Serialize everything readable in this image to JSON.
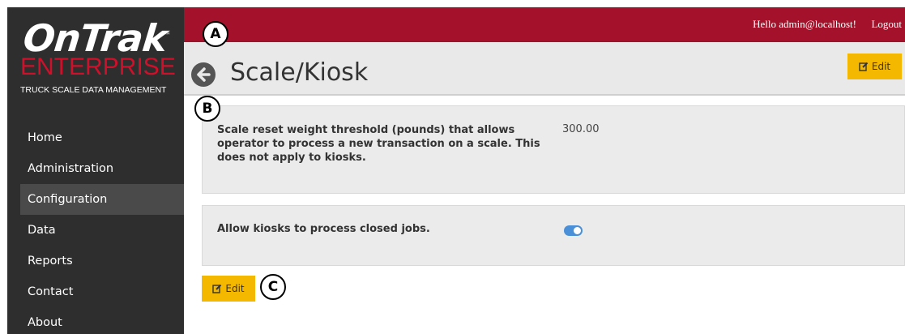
{
  "brand": {
    "name": "OnTrak",
    "trademark": "™",
    "subtitle": "ENTERPRISE",
    "tagline": "TRUCK SCALE DATA MANAGEMENT",
    "colors": {
      "red": "#a3122a",
      "accent_red": "#d0102a",
      "sidebar": "#2e2e2e",
      "edit_yellow": "#f5b800"
    }
  },
  "header": {
    "greeting": "Hello admin@localhost!",
    "logout_label": "Logout"
  },
  "sidebar": {
    "items": [
      {
        "label": "Home",
        "active": false
      },
      {
        "label": "Administration",
        "active": false
      },
      {
        "label": "Configuration",
        "active": true
      },
      {
        "label": "Data",
        "active": false
      },
      {
        "label": "Reports",
        "active": false
      },
      {
        "label": "Contact",
        "active": false
      },
      {
        "label": "About",
        "active": false
      }
    ]
  },
  "page": {
    "title": "Scale/Kiosk",
    "back_icon": "arrow-left-circle-icon",
    "edit_label": "Edit",
    "edit_icon": "edit-icon"
  },
  "settings": [
    {
      "label": "Scale reset weight threshold (pounds) that allows operator to process a new transaction on a scale. This does not apply to kiosks.",
      "value": "300.00"
    },
    {
      "label": "Allow kiosks to process closed jobs.",
      "toggle_on": true
    }
  ],
  "callouts": [
    "A",
    "B",
    "C"
  ]
}
